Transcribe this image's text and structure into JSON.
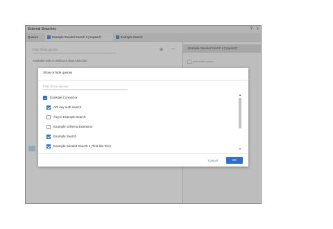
{
  "window": {
    "title": "External Searches",
    "help_label": "?",
    "close_label": "×"
  },
  "tabs": {
    "queries_label": "Queries",
    "tab1_label": "Example Seeded Search 2 ('expand')",
    "tab2_label": "Example Search"
  },
  "left_pane": {
    "filter_placeholder": "Filter these queries",
    "section_label": "Available with or without a chart selection",
    "menu_glyph": "—"
  },
  "right_pane": {
    "header": "Example Seeded Search 2 ('expand')",
    "option_label": "Add entire query"
  },
  "dialog": {
    "title": "Show or hide queries",
    "filter_placeholder": "Filter these queries",
    "items": [
      {
        "label": "Example Connector",
        "state": "partial",
        "level": 0
      },
      {
        "label": "API key auth search",
        "state": "checked",
        "level": 1
      },
      {
        "label": "Async Example Search",
        "state": "unchecked",
        "level": 1
      },
      {
        "label": "Example Schema Extension",
        "state": "unchecked",
        "level": 1
      },
      {
        "label": "Example Search",
        "state": "checked",
        "level": 1
      },
      {
        "label": "Example Seeded Search 1 ('find like this')",
        "state": "checked",
        "level": 1
      }
    ],
    "cancel_label": "Cancel",
    "ok_label": "OK"
  },
  "colors": {
    "accent": "#2f6fd0",
    "link": "#3f7ed6"
  }
}
